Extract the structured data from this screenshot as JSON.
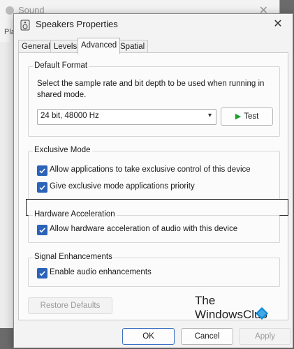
{
  "background_window": {
    "title": "Sound",
    "tab_stub": "Pla"
  },
  "dialog": {
    "title": "Speakers Properties",
    "tabs": [
      {
        "label": "General",
        "active": false
      },
      {
        "label": "Levels",
        "active": false
      },
      {
        "label": "Advanced",
        "active": true
      },
      {
        "label": "Spatial sound",
        "active": false
      }
    ],
    "default_format": {
      "heading": "Default Format",
      "description": "Select the sample rate and bit depth to be used when running in shared mode.",
      "selected_format": "24 bit, 48000 Hz",
      "test_label": "Test"
    },
    "exclusive_mode": {
      "heading": "Exclusive Mode",
      "options": [
        {
          "label": "Allow applications to take exclusive control of this device",
          "checked": true
        },
        {
          "label": "Give exclusive mode applications priority",
          "checked": true
        }
      ]
    },
    "hardware_acceleration": {
      "heading": "Hardware Acceleration",
      "option": {
        "label": "Allow hardware acceleration of audio with this device",
        "checked": true
      }
    },
    "signal_enhancements": {
      "heading": "Signal Enhancements",
      "option": {
        "label": "Enable audio enhancements",
        "checked": true
      }
    },
    "restore_defaults_label": "Restore Defaults",
    "ok_label": "OK",
    "cancel_label": "Cancel",
    "apply_label": "Apply"
  },
  "watermark": {
    "line1": "The",
    "line2": "WindowsClub"
  },
  "colors": {
    "accent": "#2b63b8",
    "test_play": "#1f9e2c",
    "dialog_bg": "#f3f3f3"
  },
  "icons": [
    "speaker-icon",
    "close-icon",
    "chevron-down-icon",
    "play-icon",
    "checkmark-icon",
    "windows-logo-icon"
  ]
}
